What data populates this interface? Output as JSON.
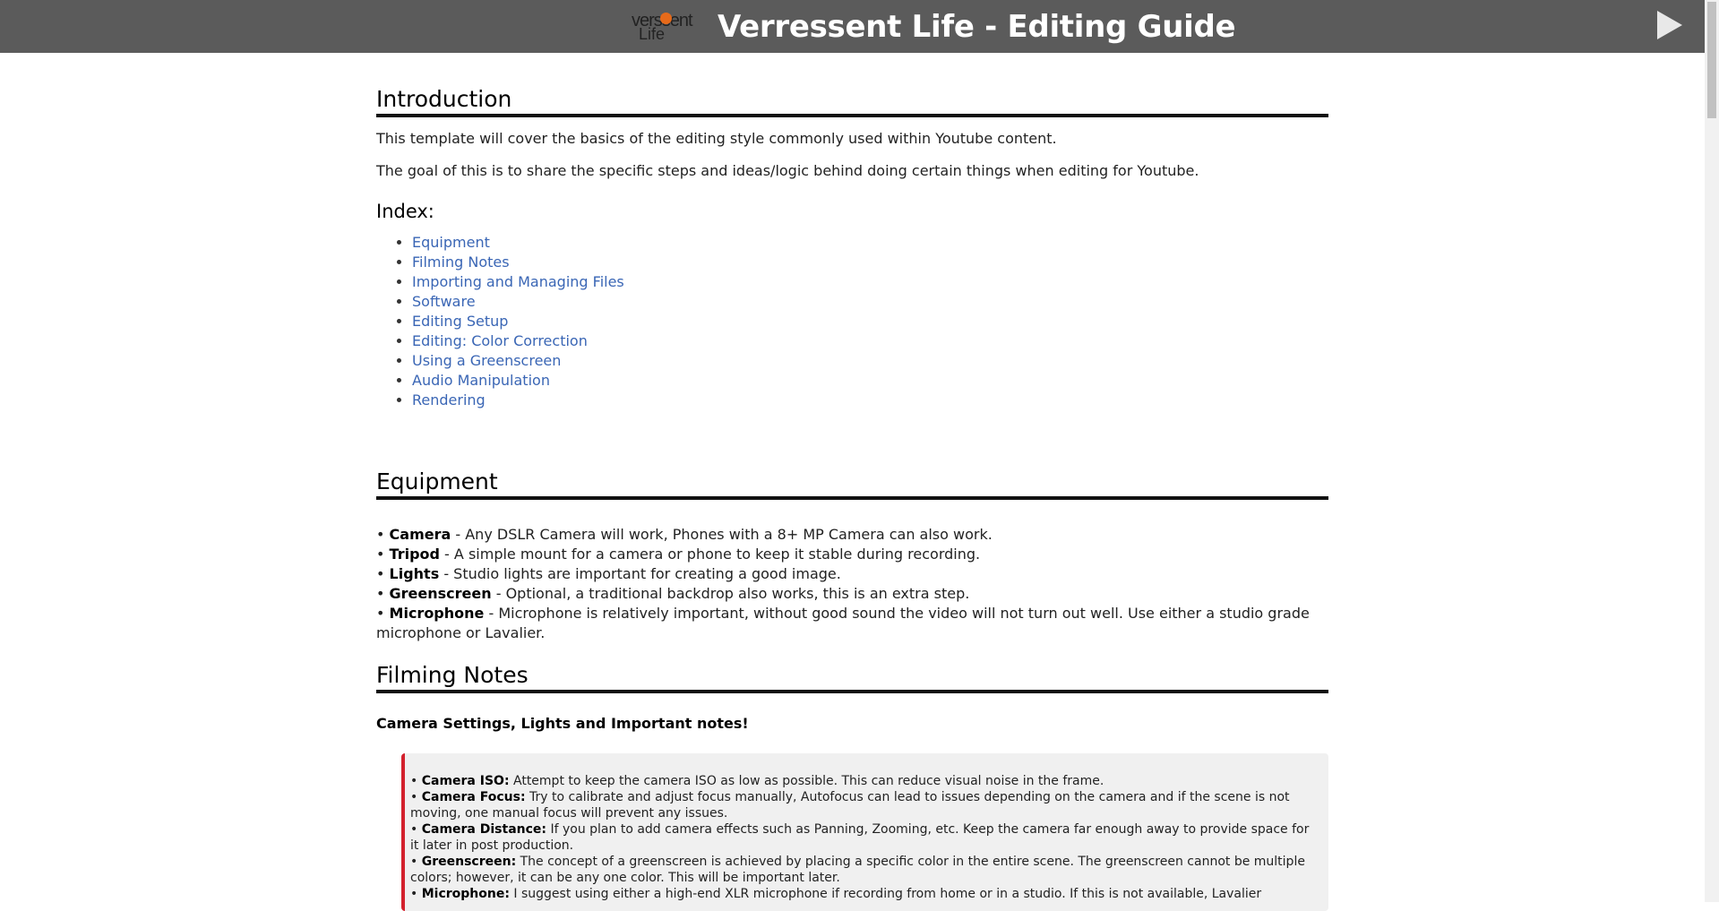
{
  "header": {
    "logo_text_top": "verssent",
    "logo_text_bottom": "Life",
    "title": "Verressent Life - Editing Guide"
  },
  "intro": {
    "heading": "Introduction",
    "p1": "This template will cover the basics of the editing style commonly used within Youtube content.",
    "p2": "The goal of this is to share the specific steps and ideas/logic behind doing certain things when editing for Youtube.",
    "index_heading": "Index:",
    "index": [
      "Equipment",
      "Filming Notes",
      "Importing and Managing Files",
      "Software",
      "Editing Setup",
      "Editing: Color Correction",
      "Using a Greenscreen",
      "Audio Manipulation",
      "Rendering"
    ]
  },
  "equipment": {
    "heading": "Equipment",
    "items": [
      {
        "name": "Camera",
        "desc": " - Any DSLR Camera will work, Phones with a 8+ MP Camera can also work."
      },
      {
        "name": "Tripod",
        "desc": " - A simple mount for a camera or phone to keep it stable during recording."
      },
      {
        "name": "Lights",
        "desc": " - Studio lights are important for creating a good image."
      },
      {
        "name": "Greenscreen",
        "desc": " - Optional, a traditional backdrop also works, this is an extra step."
      },
      {
        "name": "Microphone",
        "desc": " - Microphone is relatively important, without good sound the video will not turn out well. Use either a studio grade microphone or Lavalier."
      }
    ]
  },
  "filming": {
    "heading": "Filming Notes",
    "subheading": "Camera Settings, Lights and Important notes!",
    "notes": [
      {
        "name": "Camera ISO:",
        "desc": " Attempt to keep the camera ISO as low as possible. This can reduce visual noise in the frame."
      },
      {
        "name": "Camera Focus:",
        "desc": " Try to calibrate and adjust focus manually, Autofocus can lead to issues depending on the camera and if the scene is not moving, one manual focus will prevent any issues."
      },
      {
        "name": "Camera Distance:",
        "desc": " If you plan to add camera effects such as Panning, Zooming, etc. Keep the camera far enough away to provide space for it later in post production."
      },
      {
        "name": "Greenscreen:",
        "desc": " The concept of a greenscreen is achieved by placing a specific color in the entire scene. The greenscreen cannot be multiple colors; however, it can be any one color. This will be important later."
      },
      {
        "name": "Microphone:",
        "desc": " I suggest using either a high-end XLR microphone if recording from home or in a studio. If this is not available, Lavalier"
      }
    ]
  }
}
